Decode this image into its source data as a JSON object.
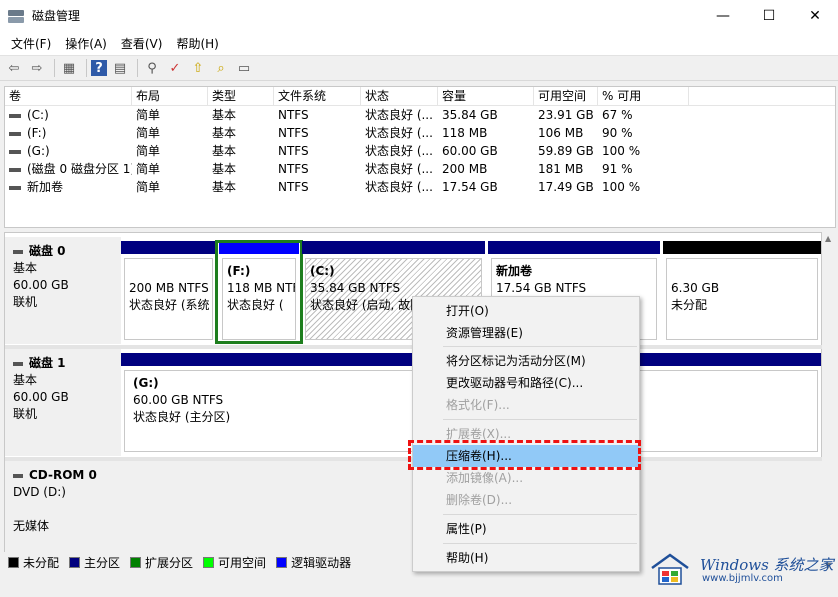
{
  "window": {
    "title": "磁盘管理",
    "minimize": "—",
    "maximize": "☐",
    "close": "✕"
  },
  "menubar": [
    "文件(F)",
    "操作(A)",
    "查看(V)",
    "帮助(H)"
  ],
  "toolbar": [
    {
      "icon": "back-arrow-icon",
      "glyph": "⇦"
    },
    {
      "icon": "forward-arrow-icon",
      "glyph": "⇨"
    },
    {
      "icon": "grid-view-icon",
      "glyph": "▦"
    },
    {
      "icon": "help-icon",
      "glyph": "?"
    },
    {
      "icon": "panel-view-icon",
      "glyph": "▤"
    },
    {
      "icon": "connect-icon",
      "glyph": "⚲"
    },
    {
      "icon": "check-icon",
      "glyph": "✓"
    },
    {
      "icon": "up-folder-icon",
      "glyph": "⇧"
    },
    {
      "icon": "search-icon",
      "glyph": "⌕"
    },
    {
      "icon": "properties-icon",
      "glyph": "▭"
    }
  ],
  "volume_list": {
    "columns": [
      "卷",
      "布局",
      "类型",
      "文件系统",
      "状态",
      "容量",
      "可用空间",
      "% 可用"
    ],
    "rows": [
      [
        "(C:)",
        "简单",
        "基本",
        "NTFS",
        "状态良好 (...",
        "35.84 GB",
        "23.91 GB",
        "67 %"
      ],
      [
        "(F:)",
        "简单",
        "基本",
        "NTFS",
        "状态良好 (...",
        "118 MB",
        "106 MB",
        "90 %"
      ],
      [
        "(G:)",
        "简单",
        "基本",
        "NTFS",
        "状态良好 (...",
        "60.00 GB",
        "59.89 GB",
        "100 %"
      ],
      [
        "(磁盘 0 磁盘分区 1)",
        "简单",
        "基本",
        "NTFS",
        "状态良好 (...",
        "200 MB",
        "181 MB",
        "91 %"
      ],
      [
        "新加卷",
        "简单",
        "基本",
        "NTFS",
        "状态良好 (...",
        "17.54 GB",
        "17.49 GB",
        "100 %"
      ]
    ]
  },
  "disks": {
    "disk0": {
      "name": "磁盘 0",
      "type": "基本",
      "size": "60.00 GB",
      "status": "联机",
      "p1": {
        "size": "200 MB NTFS",
        "status": "状态良好 (系统"
      },
      "p2": {
        "name": "(F:)",
        "size": "118 MB NTFS",
        "status": "状态良好 ("
      },
      "p3": {
        "name": "(C:)",
        "size": "35.84 GB NTFS",
        "status": "状态良好 (启动, 故障"
      },
      "p4": {
        "name": "新加卷",
        "size": "17.54 GB NTFS",
        "status": ""
      },
      "p5": {
        "size": "6.30 GB",
        "status": "未分配"
      }
    },
    "disk1": {
      "name": "磁盘 1",
      "type": "基本",
      "size": "60.00 GB",
      "status": "联机",
      "p1": {
        "name": "(G:)",
        "size": "60.00 GB NTFS",
        "status": "状态良好 (主分区)"
      }
    },
    "cdrom0": {
      "name": "CD-ROM 0",
      "type": "DVD (D:)",
      "media": "无媒体"
    }
  },
  "legend": [
    {
      "label": "未分配",
      "color": "#000000"
    },
    {
      "label": "主分区",
      "color": "#00007f"
    },
    {
      "label": "扩展分区",
      "color": "#008000"
    },
    {
      "label": "可用空间",
      "color": "#00ff00"
    },
    {
      "label": "逻辑驱动器",
      "color": "#0000ff"
    }
  ],
  "context_menu": {
    "open": "打开(O)",
    "explorer": "资源管理器(E)",
    "mark_active": "将分区标记为活动分区(M)",
    "change_letter": "更改驱动器号和路径(C)...",
    "format": "格式化(F)...",
    "extend": "扩展卷(X)...",
    "shrink": "压缩卷(H)...",
    "add_mirror": "添加镜像(A)...",
    "delete": "删除卷(D)...",
    "properties": "属性(P)",
    "help": "帮助(H)"
  },
  "watermark": {
    "line1": "Windows 系统之家",
    "line2": "www.bjjmlv.com"
  }
}
